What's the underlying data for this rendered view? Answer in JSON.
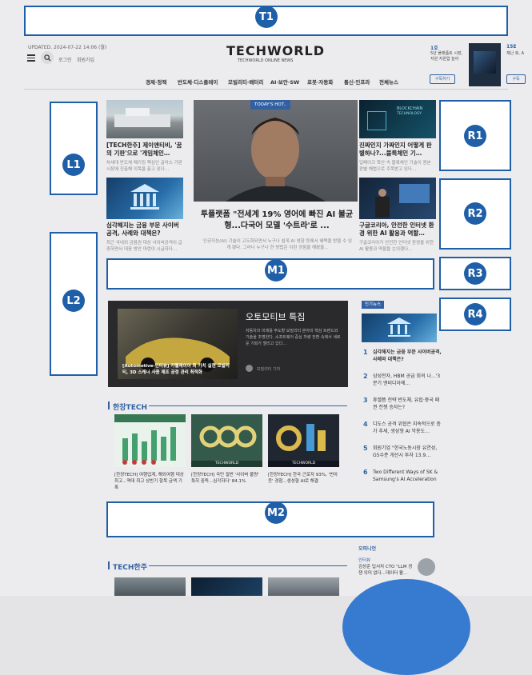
{
  "badges": [
    "T1",
    "L1",
    "L2",
    "M1",
    "M2",
    "R1",
    "R2",
    "R3",
    "R4"
  ],
  "header": {
    "updated": "UPDATED. 2024-07-22 14:06 (월)",
    "login": "로그인",
    "join": "회원가입",
    "logo": "TECHWORLD",
    "logo_sub": "TECHWORLD ONLINE NEWS",
    "promo_title_1": "1호",
    "promo_text_1": "5년 플랫폼트 시장, 지원 지원업 늘어",
    "promo_title_2": "15E",
    "promo_text_2": "재난 호, A",
    "subscribe": "구독하기",
    "subscribe_2": "구독"
  },
  "nav": [
    "경제·정책",
    "반도체·디스플레이",
    "모빌리티·배터리",
    "AI·보안·SW",
    "로봇·자동화",
    "통신·인프라",
    "전체뉴스"
  ],
  "left_articles": [
    {
      "title": "[TECH한주] 제이앤티비, '꿈의 기판'으로 '게임체인…",
      "body": "차세대 반도체 패키징 핵심인 글라스 기판 시장에 진출해 이목을 끌고 있다…"
    },
    {
      "title": "심각해지는 금융 부문 사이버공격, 사례와 대책은?",
      "body": "최근 국내외 금융권 대상 사이버공격이 급증하면서 대응 방안 마련이 시급하다…"
    }
  ],
  "hero": {
    "tag": "TODAY'S HOT..",
    "title": "투플랫폼 \"전세계 19% 영어에 빠진 AI 불균형...다국어 모델 '수트라'로 ...",
    "body": "인공지능(AI) 기술이 고도화되면서 누구나 쉽게 AI 영향 등에서 혜택을 받을 수 있게 됐다. 그러나 누구나 한 방법은 이런 경험을 해봤을…"
  },
  "right_articles": [
    {
      "title": "진짜인지 가짜인지 어떻게 판별하나?...블록체인 기…",
      "body": "딥페이크 확산 속 블록체인 기술이 원본 판별 해법으로 주목받고 있다…"
    },
    {
      "title": "구글코리아, 안전한 인터넷 환경 위한 AI 활용과 역할…",
      "body": "구글코리아가 안전한 인터넷 환경을 위한 AI 활용과 역할을 논의했다…"
    }
  ],
  "feature": {
    "title": "오토모티브 특집",
    "body": "자동차의 미래를 주도할 모빌리티 분야의 핵심 트렌드와 기술을 조명한다. 소프트웨어 중심 차량 전환 속에서 새로운 기회가 열리고 있다…",
    "image_caption": "[Automotive-인터뷰] 카펠레이아 최 가치 실현 모빌리티, 3D 스캐너 사용 제조 공정 관리 최적화",
    "author": "모빌리티 기자"
  },
  "popular": {
    "label": "인기뉴스",
    "items": [
      {
        "num": "1",
        "text": "심각해지는 금융 부문 사이버공격, 사례와 대책은?"
      },
      {
        "num": "2",
        "text": "삼성전자, HBM 공급 회의 나...'3분기 엔비디아에…"
      },
      {
        "num": "3",
        "text": "휴젤쯤 전략 반도체, 유럽·중국 패권 전쟁 승자는?"
      },
      {
        "num": "4",
        "text": "디도스 공격 위협은 지속적으로 증가 추세, 생성형 AI 악용도…"
      },
      {
        "num": "5",
        "text": "회원기업 \"한국노동시장 유연성, G5수준 개선시 투자 13.9…"
      },
      {
        "num": "6",
        "text": "Two Different Ways of SK & Samsung's AI Acceleration"
      }
    ]
  },
  "hanjang": {
    "title": "한장TECH",
    "cards": [
      {
        "caption": "[한장TECH] 여행업계, 해외여행 대상 최고...역대 최고 상반기 항목 금액 기록",
        "img_label": "TECHWORLD"
      },
      {
        "caption": "[한장TECH] 국민 절반 '사이버 불량' 특히 중독...심각하다' 84.1%",
        "img_label": "TECHWORLD"
      },
      {
        "caption": "[한장TECH] 한국 근로자 93%, '번아웃' 경험...생성형 AI로 해결",
        "img_label": "TECHWORLD"
      }
    ]
  },
  "opinion": {
    "label": "오피니언",
    "sub": "인터뷰",
    "text": "김성준 딥서치 CTO \"LLM 경쟁 의미 없다...데이터 활…"
  },
  "techhanju": {
    "title": "TECH한주"
  },
  "colors": {
    "accent": "#1f5fa8",
    "brand": "#2a62b0"
  }
}
